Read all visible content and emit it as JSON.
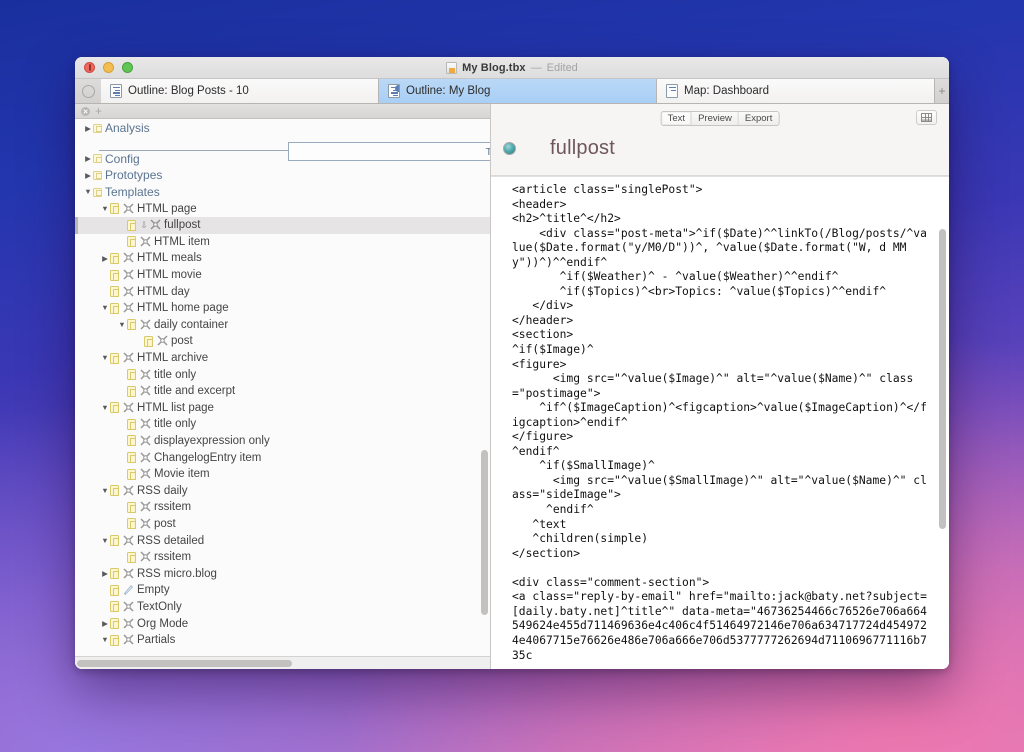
{
  "desktop": {
    "wallpaper_colors": [
      "#1a2f9e",
      "#6446bd",
      "#c978bd",
      "#f378af"
    ]
  },
  "window": {
    "titlebar": {
      "document_name": "My Blog.tbx",
      "separator": "—",
      "edited_status": "Edited",
      "close_label": "close",
      "minimize_label": "minimize",
      "zoom_label": "zoom"
    },
    "tabs": {
      "items": [
        {
          "label": "Outline: Blog Posts - 10",
          "active": false,
          "badge": false
        },
        {
          "label": "Outline: My Blog",
          "active": true,
          "badge": true
        },
        {
          "label": "Map: Dashboard",
          "active": false,
          "badge": false
        }
      ],
      "add_tab_label": "+"
    }
  },
  "sidebar": {
    "toolbar": {
      "remove_label": "×",
      "add_label": "+"
    },
    "drop_tooltip": "Ti",
    "rows": [
      {
        "indent": 0,
        "twisty": "collapsed",
        "chip": "folder",
        "icon": "none",
        "label": "Analysis",
        "selected": false,
        "group": true
      },
      {
        "indent": 0,
        "twisty": "collapsed",
        "chip": "folder",
        "icon": "none",
        "label": "Config",
        "selected": false,
        "group": true
      },
      {
        "indent": 0,
        "twisty": "collapsed",
        "chip": "folder",
        "icon": "none",
        "label": "Prototypes",
        "selected": false,
        "group": true
      },
      {
        "indent": 0,
        "twisty": "expanded",
        "chip": "folder",
        "icon": "none",
        "label": "Templates",
        "selected": false,
        "group": true
      },
      {
        "indent": 1,
        "twisty": "expanded",
        "chip": "note",
        "icon": "template",
        "label": "HTML page",
        "selected": false,
        "group": false
      },
      {
        "indent": 2,
        "twisty": "none",
        "chip": "note",
        "icon": "template",
        "label": "fullpost",
        "selected": true,
        "group": false,
        "arrow": true
      },
      {
        "indent": 2,
        "twisty": "none",
        "chip": "note",
        "icon": "template",
        "label": "HTML item",
        "selected": false,
        "group": false
      },
      {
        "indent": 1,
        "twisty": "collapsed",
        "chip": "note",
        "icon": "template",
        "label": "HTML meals",
        "selected": false,
        "group": false
      },
      {
        "indent": 1,
        "twisty": "none",
        "chip": "note",
        "icon": "template",
        "label": "HTML movie",
        "selected": false,
        "group": false
      },
      {
        "indent": 1,
        "twisty": "none",
        "chip": "note",
        "icon": "template",
        "label": "HTML day",
        "selected": false,
        "group": false
      },
      {
        "indent": 1,
        "twisty": "expanded",
        "chip": "note",
        "icon": "template",
        "label": "HTML home page",
        "selected": false,
        "group": false
      },
      {
        "indent": 2,
        "twisty": "expanded",
        "chip": "note",
        "icon": "template",
        "label": "daily container",
        "selected": false,
        "group": false
      },
      {
        "indent": 3,
        "twisty": "none",
        "chip": "note",
        "icon": "template",
        "label": "post",
        "selected": false,
        "group": false
      },
      {
        "indent": 1,
        "twisty": "expanded",
        "chip": "note",
        "icon": "template",
        "label": "HTML archive",
        "selected": false,
        "group": false
      },
      {
        "indent": 2,
        "twisty": "none",
        "chip": "note",
        "icon": "template",
        "label": "title only",
        "selected": false,
        "group": false
      },
      {
        "indent": 2,
        "twisty": "none",
        "chip": "note",
        "icon": "template",
        "label": "title and excerpt",
        "selected": false,
        "group": false
      },
      {
        "indent": 1,
        "twisty": "expanded",
        "chip": "note",
        "icon": "template",
        "label": "HTML list page",
        "selected": false,
        "group": false
      },
      {
        "indent": 2,
        "twisty": "none",
        "chip": "note",
        "icon": "template",
        "label": "title only",
        "selected": false,
        "group": false
      },
      {
        "indent": 2,
        "twisty": "none",
        "chip": "note",
        "icon": "template",
        "label": "displayexpression only",
        "selected": false,
        "group": false
      },
      {
        "indent": 2,
        "twisty": "none",
        "chip": "note",
        "icon": "template",
        "label": "ChangelogEntry item",
        "selected": false,
        "group": false
      },
      {
        "indent": 2,
        "twisty": "none",
        "chip": "note",
        "icon": "template",
        "label": "Movie item",
        "selected": false,
        "group": false
      },
      {
        "indent": 1,
        "twisty": "expanded",
        "chip": "note",
        "icon": "template",
        "label": "RSS daily",
        "selected": false,
        "group": false
      },
      {
        "indent": 2,
        "twisty": "none",
        "chip": "note",
        "icon": "template",
        "label": "rssitem",
        "selected": false,
        "group": false
      },
      {
        "indent": 2,
        "twisty": "none",
        "chip": "note",
        "icon": "template",
        "label": "post",
        "selected": false,
        "group": false
      },
      {
        "indent": 1,
        "twisty": "expanded",
        "chip": "note",
        "icon": "template",
        "label": "RSS detailed",
        "selected": false,
        "group": false
      },
      {
        "indent": 2,
        "twisty": "none",
        "chip": "note",
        "icon": "template",
        "label": "rssitem",
        "selected": false,
        "group": false
      },
      {
        "indent": 1,
        "twisty": "collapsed",
        "chip": "note",
        "icon": "template",
        "label": "RSS micro.blog",
        "selected": false,
        "group": false
      },
      {
        "indent": 1,
        "twisty": "none",
        "chip": "note",
        "icon": "pencil",
        "label": "Empty",
        "selected": false,
        "group": false
      },
      {
        "indent": 1,
        "twisty": "none",
        "chip": "note",
        "icon": "template",
        "label": "TextOnly",
        "selected": false,
        "group": false
      },
      {
        "indent": 1,
        "twisty": "collapsed",
        "chip": "note",
        "icon": "template",
        "label": "Org Mode",
        "selected": false,
        "group": false
      },
      {
        "indent": 1,
        "twisty": "expanded",
        "chip": "note",
        "icon": "template",
        "label": "Partials",
        "selected": false,
        "group": false
      }
    ]
  },
  "main": {
    "view_modes": [
      {
        "label": "Text",
        "active": true
      },
      {
        "label": "Preview",
        "active": false
      },
      {
        "label": "Export",
        "active": false
      }
    ],
    "note_title": "fullpost",
    "grid_button_label": "grid",
    "editor_text": "<article class=\"singlePost\">\n<header>\n<h2>^title^</h2>\n    <div class=\"post-meta\">^if($Date)^^linkTo(/Blog/posts/^value($Date.format(\"y/M0/D\"))^, ^value($Date.format(\"W, d MM y\"))^)^^endif^\n       ^if($Weather)^ - ^value($Weather)^^endif^\n       ^if($Topics)^<br>Topics: ^value($Topics)^^endif^\n   </div>\n</header>\n<section>\n^if($Image)^\n<figure>\n      <img src=\"^value($Image)^\" alt=\"^value($Name)^\" class=\"postimage\">\n    ^if^($ImageCaption)^<figcaption>^value($ImageCaption)^</figcaption>^endif^\n</figure>\n^endif^\n    ^if($SmallImage)^\n      <img src=\"^value($SmallImage)^\" alt=\"^value($Name)^\" class=\"sideImage\">\n     ^endif^\n   ^text\n   ^children(simple)\n</section>\n\n<div class=\"comment-section\">\n<a class=\"reply-by-email\" href=\"mailto:jack@baty.net?subject=[daily.baty.net]^title^\" data-meta=\"46736254466c76526e706a664549624e455d711469636e4c406c4f51464972146e706a634717724d4549724e4067715e76626e486e706a666e706d5377777262694d7110696771116b735c"
  }
}
